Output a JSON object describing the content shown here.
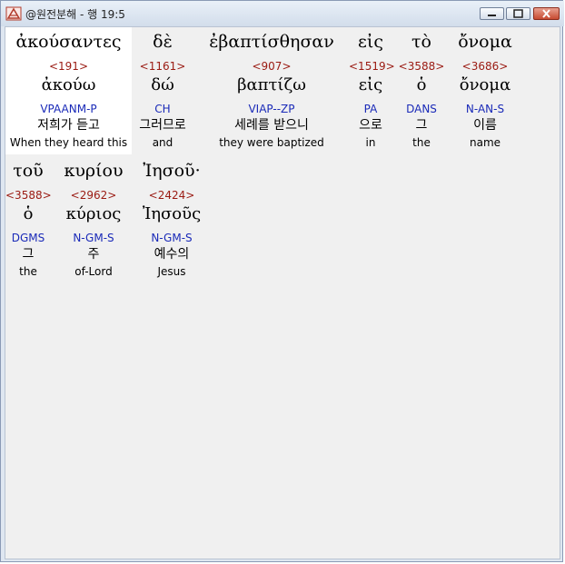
{
  "window": {
    "title": "@원전분해 - 행 19:5",
    "controls": {
      "minimize_icon": "minimize-icon",
      "maximize_icon": "maximize-icon",
      "close_icon": "close-icon"
    }
  },
  "colors": {
    "strongs": "#9a1a12",
    "parsing": "#1a2ab8",
    "highlight": "#ffffff"
  },
  "rows": [
    [
      {
        "greek": "ἀκούσαντες",
        "strongs": "<191>",
        "lemma": "ἀκούω",
        "parsing": "VPAANM-P",
        "korean": "저희가 듣고",
        "english": "When they heard this"
      },
      {
        "greek": "δὲ",
        "strongs": "<1161>",
        "lemma": "δώ",
        "parsing": "CH",
        "korean": "그러므로",
        "english": "and"
      },
      {
        "greek": "ἐβαπτίσθησαν",
        "strongs": "<907>",
        "lemma": "βαπτίζω",
        "parsing": "VIAP--ZP",
        "korean": "세례를 받으니",
        "english": "they were baptized"
      },
      {
        "greek": "εἰς",
        "strongs": "<1519>",
        "lemma": "εἰς",
        "parsing": "PA",
        "korean": "으로",
        "english": "in"
      },
      {
        "greek": "τὸ",
        "strongs": "<3588>",
        "lemma": "ὁ",
        "parsing": "DANS",
        "korean": "그",
        "english": "the"
      },
      {
        "greek": "ὄνομα",
        "strongs": "<3686>",
        "lemma": "ὄνομα",
        "parsing": "N-AN-S",
        "korean": "이름",
        "english": "name"
      }
    ],
    [
      {
        "greek": "τοῦ",
        "strongs": "<3588>",
        "lemma": "ὁ",
        "parsing": "DGMS",
        "korean": "그",
        "english": "the"
      },
      {
        "greek": "κυρίου",
        "strongs": "<2962>",
        "lemma": "κύριος",
        "parsing": "N-GM-S",
        "korean": "주",
        "english": "of-Lord"
      },
      {
        "greek": "Ἰησοῦ·",
        "strongs": "<2424>",
        "lemma": "Ἰησοῦς",
        "parsing": "N-GM-S",
        "korean": "예수의",
        "english": "Jesus"
      }
    ]
  ]
}
